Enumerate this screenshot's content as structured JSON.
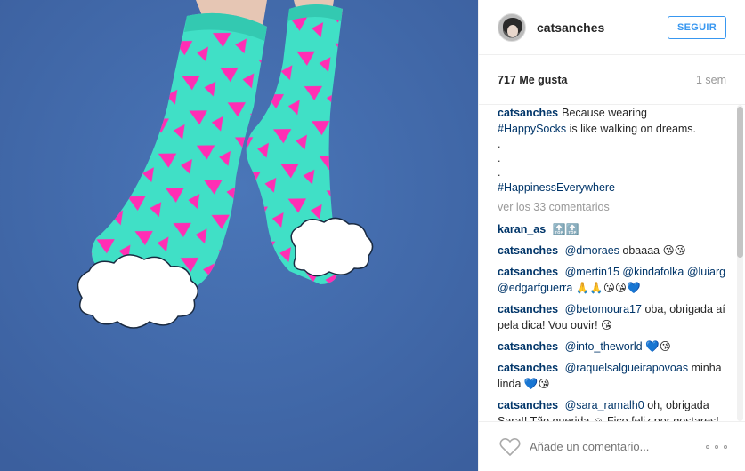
{
  "post": {
    "username": "catsanches",
    "follow_label": "SEGUIR",
    "likes": "717 Me gusta",
    "time_ago": "1 sem"
  },
  "caption": {
    "user": "catsanches",
    "text_1": "Because wearing",
    "hashtag_1": "#HappySocks",
    "text_2": "is like walking on dreams.",
    "dot_1": ".",
    "dot_2": ".",
    "dot_3": ".",
    "hashtag_2": "#HappinessEverywhere"
  },
  "view_all_label": "ver los 33 comentarios",
  "comments": [
    {
      "user": "karan_as",
      "text": "🔝🔝"
    },
    {
      "user": "catsanches",
      "mention": "@dmoraes",
      "text": "obaaaa 😘😘"
    },
    {
      "user": "catsanches",
      "mention": "@mertin15 @kindafolka @luiarg @edgarfguerra",
      "text": "🙏🙏😘😘💙"
    },
    {
      "user": "catsanches",
      "mention": "@betomoura17",
      "text": "oba, obrigada aí pela dica! Vou ouvir! 😘"
    },
    {
      "user": "catsanches",
      "mention": "@into_theworld",
      "text": "💙😘"
    },
    {
      "user": "catsanches",
      "mention": "@raquelsalgueirapovoas",
      "text": "minha linda 💙😘"
    },
    {
      "user": "catsanches",
      "mention": "@sara_ramalh0",
      "text": "oh, obrigada Sara!! Tão querida ☺ Fico feliz por gostares! Um beijinho 😘"
    }
  ],
  "footer": {
    "comment_placeholder": "Añade un comentario...",
    "heart_icon": "heart-outline-icon",
    "more_icon": "more-options-icon"
  },
  "colors": {
    "background_blue": "#3f68a8",
    "sock_teal": "#3fe0c5",
    "triangle_pink": "#ff2eb4",
    "link_blue": "#003569",
    "button_blue": "#3897f0"
  }
}
